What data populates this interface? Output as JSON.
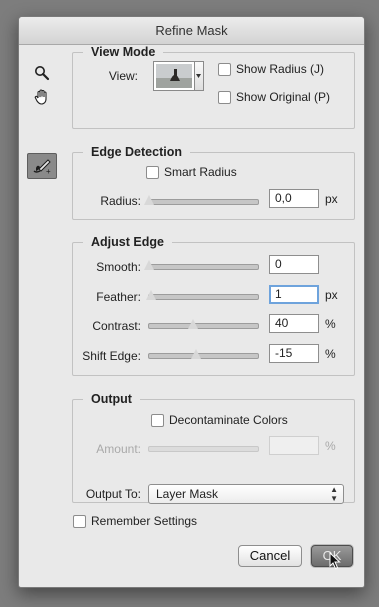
{
  "dialog": {
    "title": "Refine Mask"
  },
  "tools": {
    "zoom_icon": "magnifier-icon",
    "hand_icon": "hand-icon",
    "brush_icon": "refine-radius-brush-icon"
  },
  "view_mode": {
    "title": "View Mode",
    "view_label": "View:",
    "show_radius": {
      "label": "Show Radius (J)",
      "checked": false
    },
    "show_original": {
      "label": "Show Original (P)",
      "checked": false
    }
  },
  "edge_detection": {
    "title": "Edge Detection",
    "smart_radius": {
      "label": "Smart Radius",
      "checked": false
    },
    "radius": {
      "label": "Radius:",
      "value": "0,0",
      "unit": "px",
      "slider_fraction": 0.0
    }
  },
  "adjust_edge": {
    "title": "Adjust Edge",
    "smooth": {
      "label": "Smooth:",
      "value": "0",
      "unit": "",
      "slider_fraction": 0.0
    },
    "feather": {
      "label": "Feather:",
      "value": "1",
      "unit": "px",
      "slider_fraction": 0.02
    },
    "contrast": {
      "label": "Contrast:",
      "value": "40",
      "unit": "%",
      "slider_fraction": 0.4
    },
    "shift_edge": {
      "label": "Shift Edge:",
      "value": "-15",
      "unit": "%",
      "slider_fraction": 0.42
    }
  },
  "output": {
    "title": "Output",
    "decontaminate": {
      "label": "Decontaminate Colors",
      "checked": false
    },
    "amount": {
      "label": "Amount:",
      "value": "",
      "unit": "%",
      "enabled": false
    },
    "output_to": {
      "label": "Output To:",
      "selected": "Layer Mask"
    }
  },
  "remember_settings": {
    "label": "Remember Settings",
    "checked": false
  },
  "buttons": {
    "cancel": "Cancel",
    "ok": "OK"
  }
}
